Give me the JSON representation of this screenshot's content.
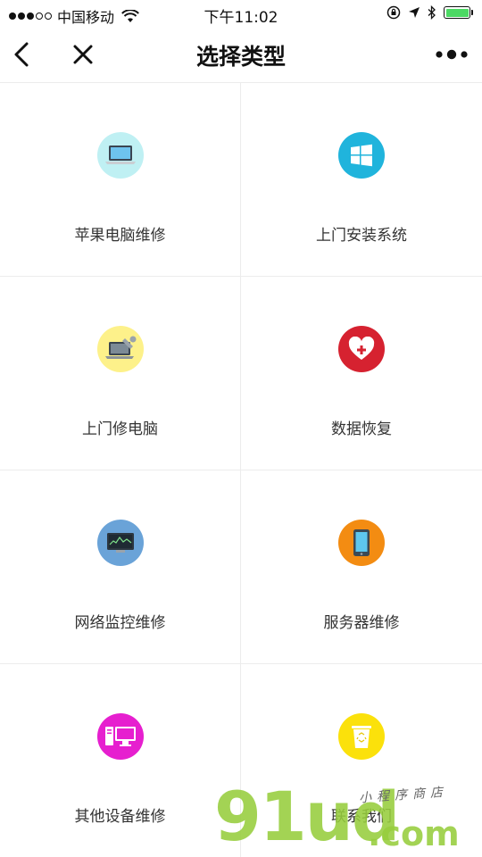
{
  "status_bar": {
    "carrier": "中国移动",
    "time": "下午11:02"
  },
  "nav": {
    "title": "选择类型"
  },
  "tiles": [
    {
      "label": "苹果电脑维修",
      "icon": "macbook-icon",
      "color": "#bff0f3"
    },
    {
      "label": "上门安装系统",
      "icon": "windows-logo-icon",
      "color": "#20b4dc"
    },
    {
      "label": "上门修电脑",
      "icon": "laptop-repair-icon",
      "color": "#fdf18a"
    },
    {
      "label": "数据恢复",
      "icon": "heart-plus-icon",
      "color": "#d62230"
    },
    {
      "label": "网络监控维修",
      "icon": "monitor-chart-icon",
      "color": "#6aa3d8"
    },
    {
      "label": "服务器维修",
      "icon": "server-device-icon",
      "color": "#f38c12"
    },
    {
      "label": "其他设备维修",
      "icon": "desktop-pc-icon",
      "color": "#e61fcf"
    },
    {
      "label": "联系我们",
      "icon": "recycle-bin-icon",
      "color": "#fbe10b"
    }
  ],
  "watermark": {
    "main": "91ud",
    "dot": ".com",
    "sub": "小程序商店"
  },
  "battery_color": "#4cd964"
}
